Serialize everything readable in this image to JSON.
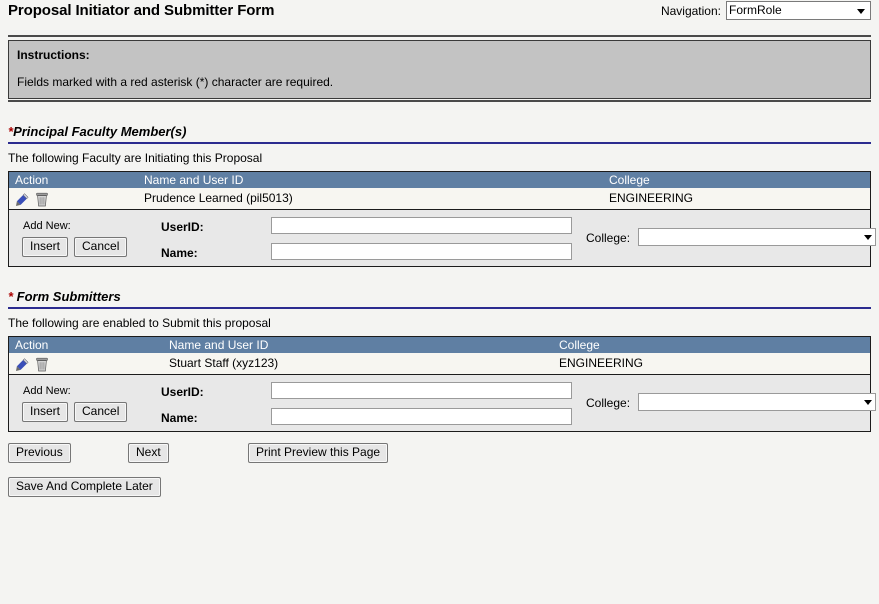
{
  "header": {
    "title": "Proposal Initiator and Submitter Form",
    "navigation_label": "Navigation:",
    "navigation_value": "FormRole"
  },
  "instructions": {
    "title": "Instructions:",
    "text": "Fields marked with a red asterisk (*) character are required."
  },
  "sections": [
    {
      "asterisk": "*",
      "heading": "Principal Faculty Member(s)",
      "subheading": "The following Faculty are Initiating this Proposal",
      "columns": {
        "action": "Action",
        "name": "Name and User ID",
        "college": "College"
      },
      "rows": [
        {
          "edit_icon": "pencil-icon",
          "delete_icon": "trash-icon",
          "name": "Prudence Learned (pil5013)",
          "college": "ENGINEERING"
        }
      ],
      "add_new": {
        "label": "Add New:",
        "insert_label": "Insert",
        "cancel_label": "Cancel",
        "userid_label": "UserID:",
        "userid_value": "",
        "name_label": "Name:",
        "name_value": "",
        "college_label": "College:",
        "college_value": ""
      }
    },
    {
      "asterisk": "*",
      "heading": " Form Submitters",
      "subheading": "The following are enabled to Submit this proposal",
      "columns": {
        "action": "Action",
        "name": "Name and User ID",
        "college": "College"
      },
      "rows": [
        {
          "edit_icon": "pencil-icon",
          "delete_icon": "trash-icon",
          "name": "Stuart Staff (xyz123)",
          "college": "ENGINEERING"
        }
      ],
      "add_new": {
        "label": "Add New:",
        "insert_label": "Insert",
        "cancel_label": "Cancel",
        "userid_label": "UserID:",
        "userid_value": "",
        "name_label": "Name:",
        "name_value": "",
        "college_label": "College:",
        "college_value": ""
      }
    }
  ],
  "footer": {
    "previous_label": "Previous",
    "next_label": "Next",
    "print_preview_label": "Print Preview this Page",
    "save_later_label": "Save And Complete Later"
  },
  "colors": {
    "table_header_blue": "#5f7fa3",
    "section_rule_blue": "#2b2b8f",
    "required_red": "#aa0000",
    "instructions_grey": "#c3c3c3",
    "page_background": "#f4f4f2"
  }
}
